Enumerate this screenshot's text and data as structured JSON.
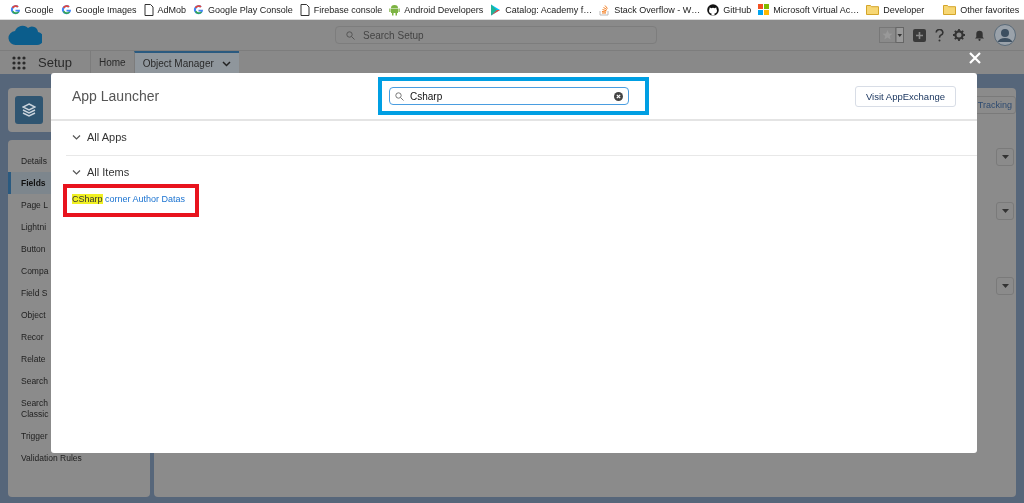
{
  "bookmarks": [
    {
      "kind": "google",
      "label": "Google"
    },
    {
      "kind": "google",
      "label": "Google Images"
    },
    {
      "kind": "page",
      "label": "AdMob"
    },
    {
      "kind": "google",
      "label": "Google Play Console"
    },
    {
      "kind": "page",
      "label": "Firebase console"
    },
    {
      "kind": "android",
      "label": "Android Developers"
    },
    {
      "kind": "play",
      "label": "Catalog: Academy f…"
    },
    {
      "kind": "stack",
      "label": "Stack Overflow - W…"
    },
    {
      "kind": "github",
      "label": "GitHub"
    },
    {
      "kind": "microsoft",
      "label": "Microsoft Virtual Ac…"
    },
    {
      "kind": "folder",
      "label": "Developer"
    }
  ],
  "other_bookmarks": {
    "label": "Other favorites"
  },
  "header": {
    "search": {
      "placeholder": "Search Setup"
    }
  },
  "nav": {
    "app_name": "Setup",
    "tabs": [
      {
        "label": "Home",
        "selected": false
      },
      {
        "label": "Object Manager",
        "selected": true
      }
    ]
  },
  "sidebar": {
    "items": [
      {
        "label": "Details",
        "selected": false
      },
      {
        "label": "Fields",
        "selected": true
      },
      {
        "label": "Page L",
        "selected": false
      },
      {
        "label": "Lightni",
        "selected": false
      },
      {
        "label": "Button",
        "selected": false
      },
      {
        "label": "Compa",
        "selected": false
      },
      {
        "label": "Field S",
        "selected": false
      },
      {
        "label": "Object",
        "selected": false
      },
      {
        "label": "Recor",
        "selected": false
      },
      {
        "label": "Relate",
        "selected": false
      },
      {
        "label": "Search",
        "selected": false
      },
      {
        "label": "Search Classic",
        "selected": false
      },
      {
        "label": "Trigger",
        "selected": false
      },
      {
        "label": "Validation Rules",
        "selected": false
      }
    ]
  },
  "content": {
    "button": "Tracking"
  },
  "app_launcher": {
    "title": "App Launcher",
    "search": {
      "value": "Csharp"
    },
    "button": "Visit AppExchange",
    "sections": [
      {
        "label": "All Apps",
        "expanded": true
      },
      {
        "label": "All Items",
        "expanded": true,
        "items": [
          {
            "match": "CSharp",
            "rest": " corner Author Datas"
          }
        ]
      }
    ]
  }
}
